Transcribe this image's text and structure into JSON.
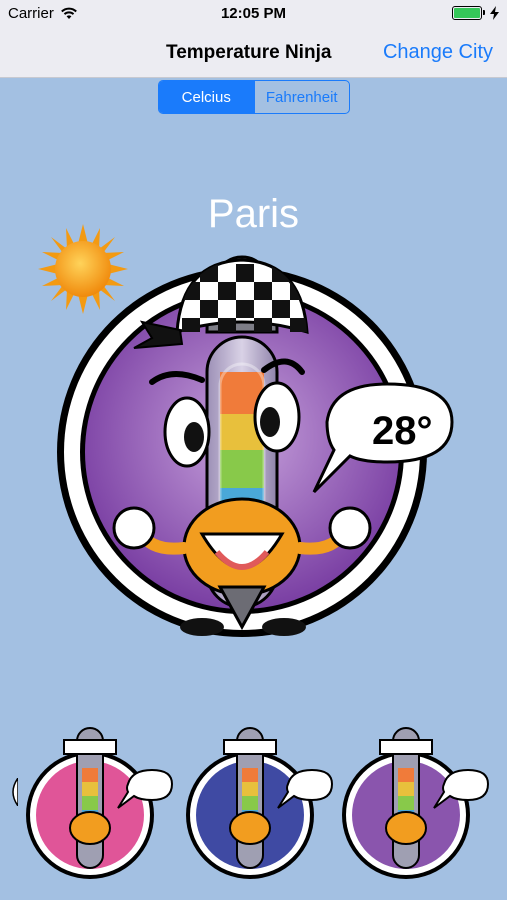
{
  "status_bar": {
    "carrier": "Carrier",
    "time": "12:05 PM"
  },
  "nav": {
    "title": "Temperature Ninja",
    "action_label": "Change City"
  },
  "unit_toggle": {
    "options": [
      "Celcius",
      "Fahrenheit"
    ],
    "selected": "Celcius"
  },
  "city": {
    "name": "Paris"
  },
  "weather": {
    "temperature": "28°",
    "condition_icon": "sun-icon"
  },
  "carousel": {
    "items": [
      {
        "icon": "ninja-thermometer-icon",
        "color": "#e05598"
      },
      {
        "icon": "ninja-thermometer-icon",
        "color": "#3f4aa3"
      },
      {
        "icon": "ninja-thermometer-icon",
        "color": "#8a55ad"
      }
    ]
  },
  "colors": {
    "background": "#a3c0e2",
    "accent": "#1a7bfb",
    "main_disc": "#8e5cb8"
  }
}
